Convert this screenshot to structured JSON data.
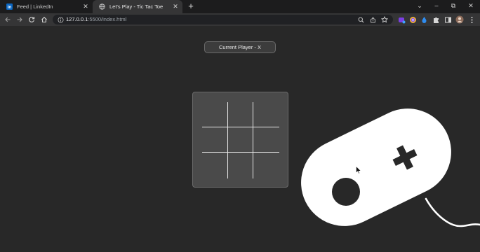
{
  "browser": {
    "tabs": [
      {
        "title": "Feed | LinkedIn",
        "favicon": "linkedin-icon",
        "active": false
      },
      {
        "title": "Let's Play - Tic Tac Toe",
        "favicon": "globe-icon",
        "active": true
      }
    ],
    "new_tab_glyph": "+",
    "url_host": "127.0.0.1",
    "url_rest": ":5500/index.html",
    "window_controls": {
      "dropdown": "⌄",
      "minimize": "–",
      "restore": "⧉",
      "close": "✕"
    }
  },
  "game": {
    "status_label": "Current Player - X",
    "board": [
      "",
      "",
      "",
      "",
      "",
      "",
      "",
      "",
      ""
    ]
  },
  "colors": {
    "page_background": "#282828",
    "board_background": "#4a4a4a",
    "controller": "#ffffff",
    "tab_strip": "#1c1c1d",
    "toolbar": "#353536"
  }
}
